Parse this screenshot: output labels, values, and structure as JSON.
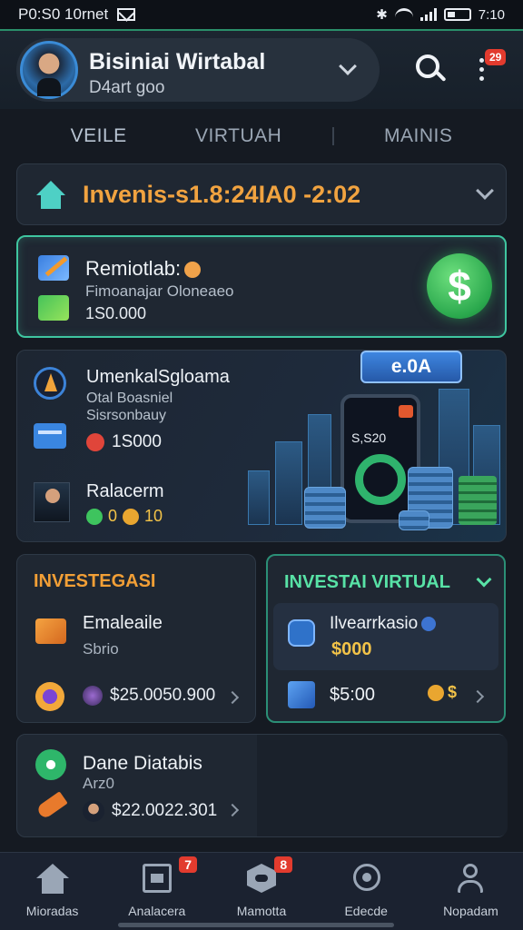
{
  "status_bar": {
    "time_left": "P0:S0 10rnet",
    "time_right": "7:10"
  },
  "header": {
    "account_name": "Bisiniai Wirtabal",
    "account_sub": "D4art goo",
    "notification_count": "29"
  },
  "tabs": [
    {
      "label": "VEILE"
    },
    {
      "label": "VIRTUAH"
    },
    {
      "label": "MAINIS"
    }
  ],
  "filter": {
    "label": "Invenis-s1.8:24IA0 -2:02"
  },
  "promo": {
    "title": "Remiotlab:",
    "subtitle": "Fimoanajar Oloneaeo",
    "amount": "1S0.000",
    "action_symbol": "$"
  },
  "hero": {
    "title": "UmenkalSgloama",
    "subtitle1": "Otal Boasniel",
    "subtitle2": "Sisrsonbauy",
    "points": "1S000",
    "name": "Ralacerm",
    "coins_a": "0",
    "coins_b": "10",
    "rate_chip": "e.0A",
    "phone_value": "S,S20"
  },
  "investasi": {
    "title": "INVESTEGASI",
    "item_name": "Emaleaile",
    "item_sub": "Sbrio",
    "amount": "$25.0050.900"
  },
  "investasi_virtual": {
    "title": "INVESTAI VIRTUAL",
    "item_name": "Ilvearrkasio",
    "item_value": "$000",
    "amount": "$5:00",
    "coin_label": "$"
  },
  "dane": {
    "title": "Dane Diatabis",
    "subtitle": "Arz0",
    "amount": "$22.0022.301"
  },
  "bottom_nav": [
    {
      "label": "Mioradas",
      "badge": ""
    },
    {
      "label": "Analacera",
      "badge": "7"
    },
    {
      "label": "Mamotta",
      "badge": "8"
    },
    {
      "label": "Edecde",
      "badge": ""
    },
    {
      "label": "Nopadam",
      "badge": ""
    }
  ]
}
